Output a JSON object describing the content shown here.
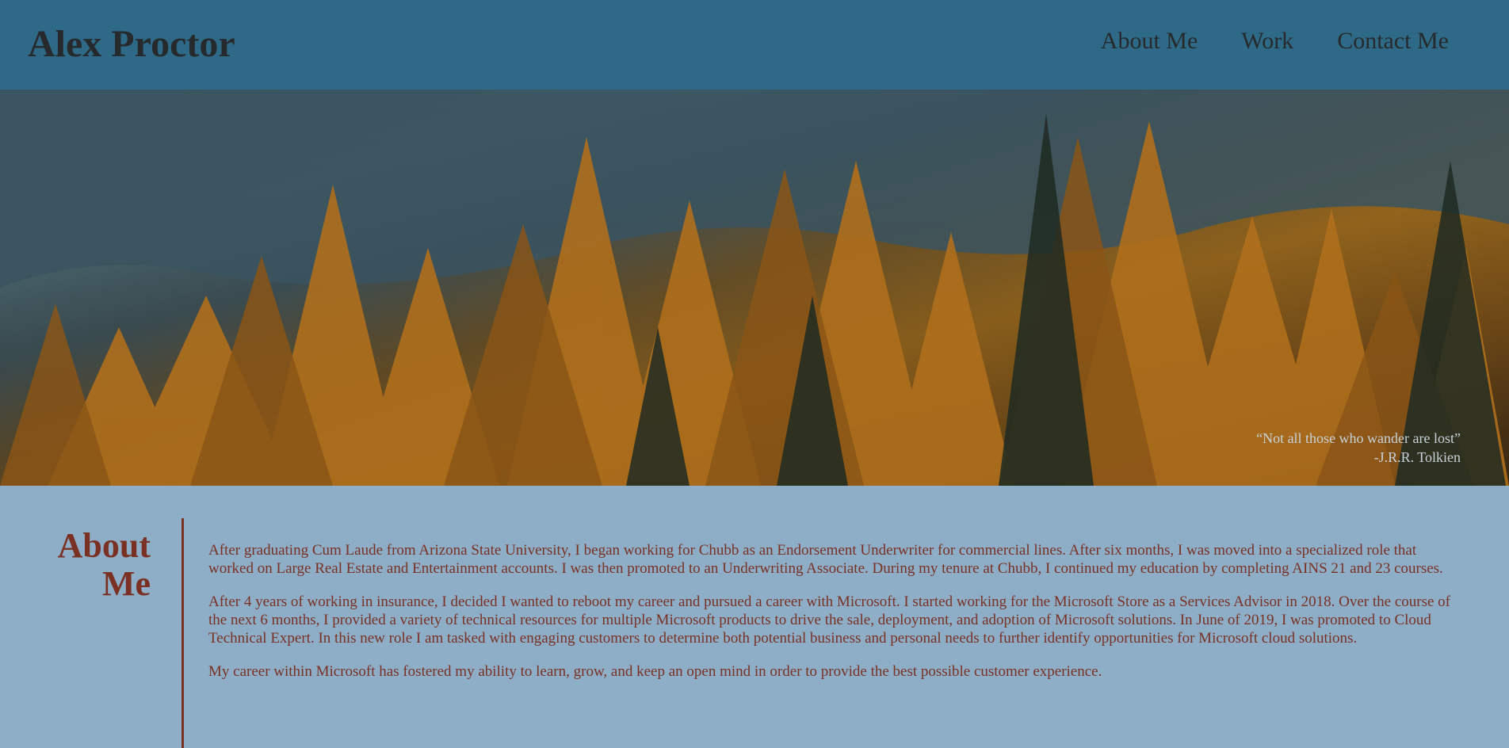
{
  "header": {
    "site_title": "Alex Proctor",
    "nav": [
      {
        "label": "About Me"
      },
      {
        "label": "Work"
      },
      {
        "label": "Contact Me"
      }
    ]
  },
  "hero": {
    "quote_text": "“Not all those who wander are lost”",
    "quote_author": "-J.R.R. Tolkien"
  },
  "about": {
    "heading": "About Me",
    "paragraphs": [
      "After graduating Cum Laude from Arizona State University, I began working for Chubb as an Endorsement Underwriter for commercial lines. After six months, I was moved into a specialized role that worked on Large Real Estate and Entertainment accounts. I was then promoted to an Underwriting Associate. During my tenure at Chubb, I continued my education by completing AINS 21 and 23 courses.",
      "After 4 years of working in insurance, I decided I wanted to reboot my career and pursued a career with Microsoft. I started working for the Microsoft Store as a Services Advisor in 2018. Over the course of the next 6 months, I provided a variety of technical resources for multiple Microsoft products to drive the sale, deployment, and adoption of Microsoft solutions. In June of 2019, I was promoted to Cloud Technical Expert. In this new role I am tasked with engaging customers to determine both potential business and personal needs to further identify opportunities for Microsoft cloud solutions.",
      "My career within Microsoft has fostered my ability to learn, grow, and keep an open mind in order to provide the best possible customer experience."
    ]
  },
  "colors": {
    "header_bg": "#2e6a87",
    "page_bg": "#8daec6",
    "accent": "#7a3124",
    "title_text": "#262a2c"
  }
}
